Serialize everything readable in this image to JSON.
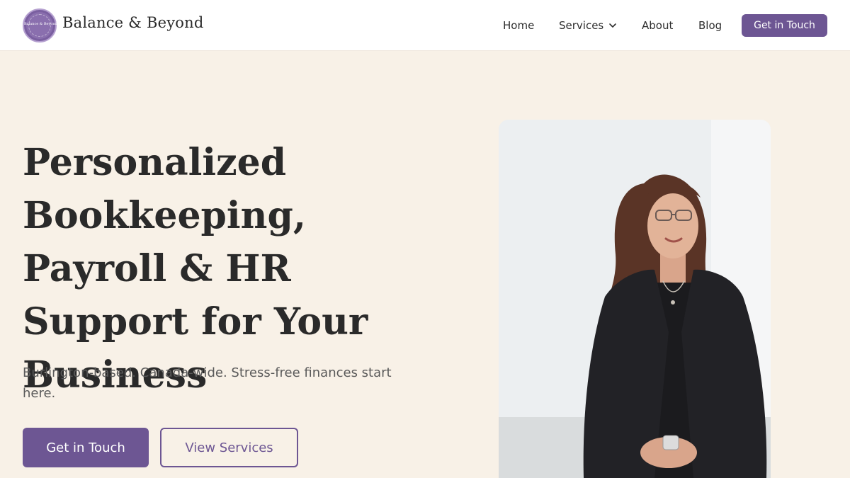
{
  "header": {
    "brand": "Balance & Beyond",
    "logo_text": "Balance & Beyond",
    "nav": {
      "home": "Home",
      "services": "Services",
      "about": "About",
      "blog": "Blog",
      "cta": "Get in Touch"
    }
  },
  "hero": {
    "title": "Personalized Bookkeeping, Payroll & HR Support for Your Business",
    "subtitle": "Burlington-based. Canada-wide. Stress-free finances start here.",
    "primary_button": "Get in Touch",
    "secondary_button": "View Services"
  },
  "colors": {
    "accent": "#6d5693",
    "background": "#f8f1e7",
    "header": "#ffffff"
  },
  "icons": {
    "services_dropdown": "chevron-down-icon"
  }
}
